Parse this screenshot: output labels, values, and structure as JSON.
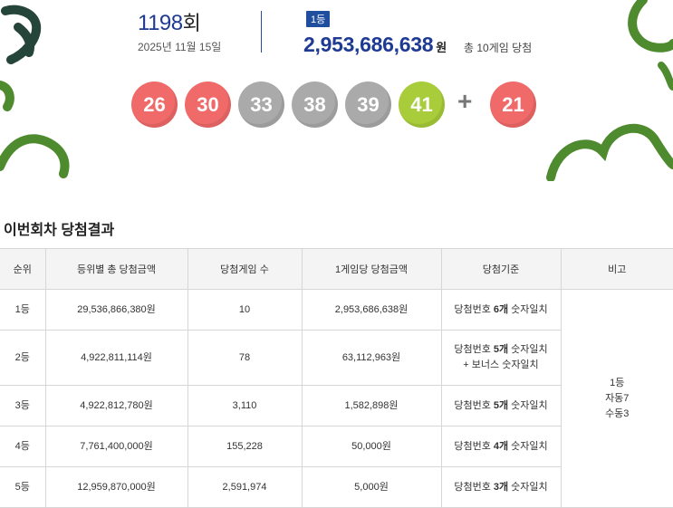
{
  "draw": {
    "round_number": "1198",
    "round_suffix": "회",
    "date": "2025년 11월 15일"
  },
  "prize": {
    "rank_badge": "1등",
    "amount": "2,953,686,638",
    "unit": "원",
    "winners_text": "총 10게임 당첨"
  },
  "balls": [
    {
      "number": "26",
      "color": "#f06a6a"
    },
    {
      "number": "30",
      "color": "#f06a6a"
    },
    {
      "number": "33",
      "color": "#aaaaaa"
    },
    {
      "number": "38",
      "color": "#aaaaaa"
    },
    {
      "number": "39",
      "color": "#aaaaaa"
    },
    {
      "number": "41",
      "color": "#a8cc3a"
    }
  ],
  "plus_symbol": "+",
  "bonus_ball": {
    "number": "21",
    "color": "#f06a6a"
  },
  "section_title": "이번회차 당첨결과",
  "table": {
    "headers": [
      "순위",
      "등위별 총 당첨금액",
      "당첨게임 수",
      "1게임당 당첨금액",
      "당첨기준",
      "비고"
    ],
    "rows": [
      {
        "rank": "1등",
        "total": "29,536,866,380원",
        "games": "10",
        "per_game": "2,953,686,638원",
        "criteria_pre": "당첨번호 ",
        "criteria_bold": "6개",
        "criteria_post": " 숫자일치",
        "criteria_line2": ""
      },
      {
        "rank": "2등",
        "total": "4,922,811,114원",
        "games": "78",
        "per_game": "63,112,963원",
        "criteria_pre": "당첨번호 ",
        "criteria_bold": "5개",
        "criteria_post": " 숫자일치",
        "criteria_line2": "+ 보너스 숫자일치"
      },
      {
        "rank": "3등",
        "total": "4,922,812,780원",
        "games": "3,110",
        "per_game": "1,582,898원",
        "criteria_pre": "당첨번호 ",
        "criteria_bold": "5개",
        "criteria_post": " 숫자일치",
        "criteria_line2": ""
      },
      {
        "rank": "4등",
        "total": "7,761,400,000원",
        "games": "155,228",
        "per_game": "50,000원",
        "criteria_pre": "당첨번호 ",
        "criteria_bold": "4개",
        "criteria_post": " 숫자일치",
        "criteria_line2": ""
      },
      {
        "rank": "5등",
        "total": "12,959,870,000원",
        "games": "2,591,974",
        "per_game": "5,000원",
        "criteria_pre": "당첨번호 ",
        "criteria_bold": "3개",
        "criteria_post": " 숫자일치",
        "criteria_line2": ""
      }
    ],
    "note": {
      "line1": "1등",
      "line2": "자동7",
      "line3": "수동3"
    }
  },
  "colors": {
    "deco_green": "#4e8a2e",
    "deco_dark": "#25453a",
    "accent_blue": "#1f3a93"
  }
}
